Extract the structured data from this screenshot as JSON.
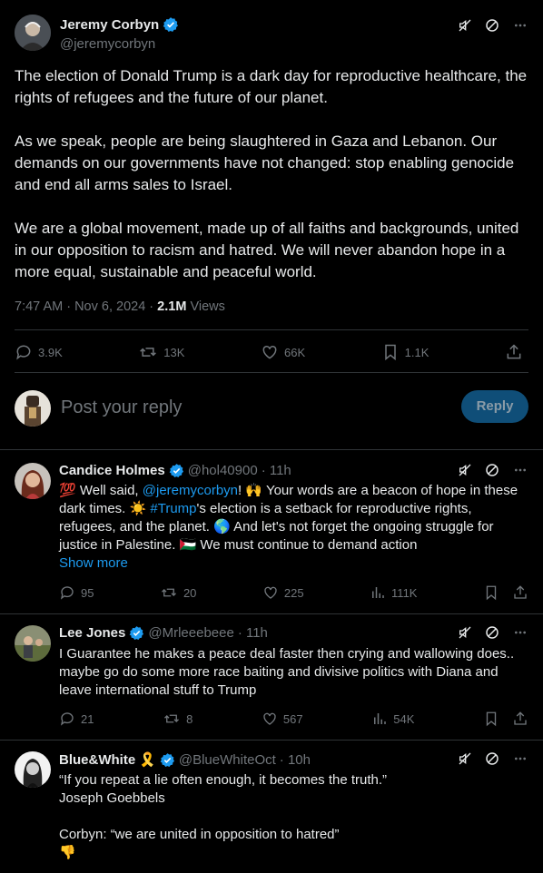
{
  "main_tweet": {
    "author_name": "Jeremy Corbyn",
    "handle": "@jeremycorbyn",
    "paragraphs": [
      "The election of Donald Trump is a dark day for reproductive healthcare, the rights of refugees and the future of our planet.",
      "As we speak, people are being slaughtered in Gaza and Lebanon. Our demands on our governments have not changed: stop enabling genocide and end all arms sales to Israel.",
      "We are a global movement, made up of all faiths and backgrounds, united in our opposition to racism and hatred. We will never abandon hope in a more equal, sustainable and peaceful world."
    ],
    "time": "7:47 AM · Nov 6, 2024 · ",
    "views_count": "2.1M",
    "views_label": " Views",
    "stats": {
      "replies": "3.9K",
      "reposts": "13K",
      "likes": "66K",
      "bookmarks": "1.1K"
    }
  },
  "composer": {
    "placeholder": "Post your reply",
    "button_label": "Reply"
  },
  "replies": [
    {
      "name": "Candice Holmes",
      "handle": "@hol40900",
      "time": "· 11h",
      "text_parts": {
        "p1": "💯 Well said, ",
        "mention": "@jeremycorbyn",
        "p2": "! 🙌 Your words are a beacon of hope in these dark times. ☀️ ",
        "hashtag": "#Trump",
        "p3": "'s election is a setback for reproductive rights, refugees, and the planet. 🌎 And let's not forget the ongoing struggle for justice in Palestine. 🇵🇸 We must continue to demand action"
      },
      "show_more": "Show more",
      "stats": {
        "replies": "95",
        "reposts": "20",
        "likes": "225",
        "views": "111K"
      }
    },
    {
      "name": "Lee Jones",
      "handle": "@Mrleeebeee",
      "time": "· 11h",
      "text": "I Guarantee he makes a peace deal faster then crying and wallowing does.. maybe go do some more race baiting and divisive politics with Diana and leave international stuff to Trump",
      "stats": {
        "replies": "21",
        "reposts": "8",
        "likes": "567",
        "views": "54K"
      }
    },
    {
      "name": "Blue&White",
      "name_emoji": "🎗️",
      "handle": "@BlueWhiteOct",
      "time": "· 10h",
      "lines": [
        "“If you repeat a lie often enough, it becomes the truth.”",
        "Joseph Goebbels",
        "Corbyn: “we are united in opposition to hatred”",
        "👎"
      ]
    }
  ],
  "colors": {
    "background": "#000000",
    "text": "#e7e9ea",
    "muted": "#71767b",
    "accent": "#1d9bf0",
    "divider": "#2f3336",
    "reply_button": "#0f4e78"
  },
  "icons": [
    "verified-badge-icon",
    "mute-icon",
    "block-icon",
    "more-icon",
    "reply-icon",
    "repost-icon",
    "like-icon",
    "bookmark-icon",
    "share-icon",
    "views-icon"
  ]
}
